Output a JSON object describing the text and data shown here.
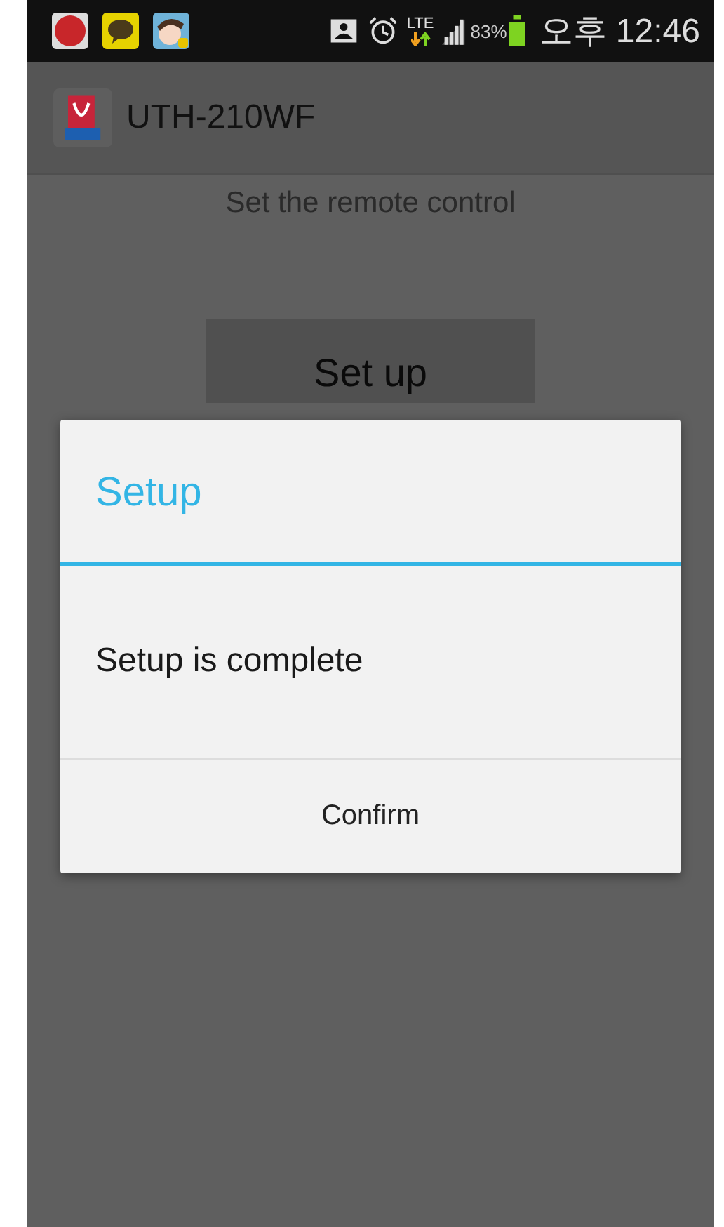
{
  "status_bar": {
    "network": "LTE",
    "battery": "83%",
    "time": "오후 12:46"
  },
  "app_bar": {
    "title": "UTH-210WF"
  },
  "content": {
    "instruction": "Set the remote control",
    "button": "Set up"
  },
  "dialog": {
    "title": "Setup",
    "message": "Setup is complete",
    "buttons": [
      "Confirm"
    ]
  }
}
